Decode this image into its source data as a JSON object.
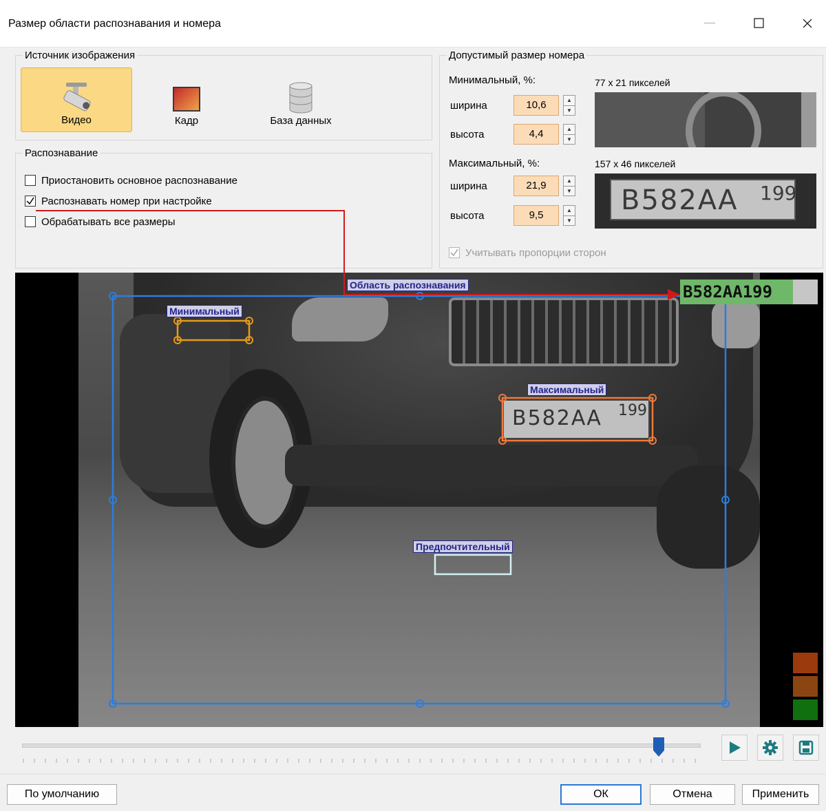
{
  "window": {
    "title": "Размер области распознавания и номера",
    "minimize_icon": "minimize-icon",
    "maximize_icon": "maximize-icon",
    "close_icon": "close-icon"
  },
  "source": {
    "legend": "Источник изображения",
    "buttons": [
      {
        "label": "Видео",
        "icon": "camera-icon",
        "selected": true
      },
      {
        "label": "Кадр",
        "icon": "frame-icon",
        "selected": false
      },
      {
        "label": "База данных",
        "icon": "database-icon",
        "selected": false
      }
    ]
  },
  "recognition": {
    "legend": "Распознавание",
    "options": [
      {
        "label": "Приостановить основное распознавание",
        "checked": false
      },
      {
        "label": "Распознавать номер при настройке",
        "checked": true
      },
      {
        "label": "Обрабатывать все размеры",
        "checked": false
      }
    ]
  },
  "plate_size": {
    "legend": "Допустимый размер номера",
    "min": {
      "title": "Минимальный, %:",
      "pixels": "77 x 21 пикселей",
      "width_label": "ширина",
      "width": "10,6",
      "height_label": "высота",
      "height": "4,4"
    },
    "max": {
      "title": "Максимальный, %:",
      "pixels": "157 x 46 пикселей",
      "width_label": "ширина",
      "width": "21,9",
      "height_label": "высота",
      "height": "9,5",
      "preview_plate": "В582АА",
      "preview_region": "199"
    },
    "aspect_label": "Учитывать пропорции сторон",
    "aspect_checked": true
  },
  "overlay": {
    "area_label": "Область распознавания",
    "min_label": "Минимальный",
    "max_label": "Максимальный",
    "pref_label": "Предпочтительный",
    "result": "В582АА199",
    "plate_main": "В582АА",
    "plate_region": "199",
    "status_colors": [
      "#9b3a0c",
      "#8b4513",
      "#107010"
    ]
  },
  "playback": {
    "slider_position": 0.94,
    "play_icon": "play-icon",
    "settings_icon": "gear-icon",
    "save_icon": "save-icon"
  },
  "footer": {
    "defaults": "По умолчанию",
    "ok": "ОК",
    "cancel": "Отмена",
    "apply": "Применить"
  }
}
